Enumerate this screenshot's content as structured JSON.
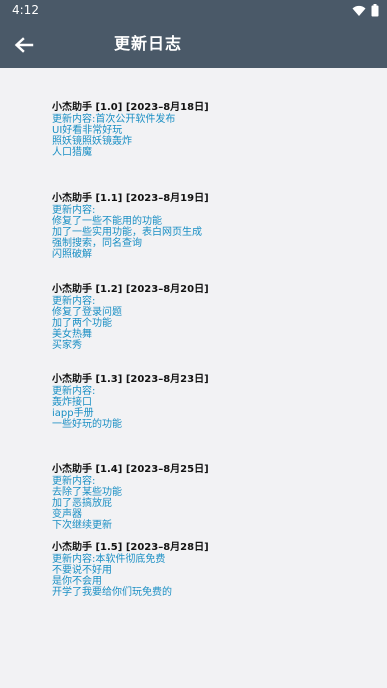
{
  "status_bar": {
    "time": "4:12"
  },
  "toolbar": {
    "title": "更新日志"
  },
  "logs": [
    {
      "title": "小杰助手 [1.0] [2023–8月18日]",
      "lines": [
        "更新内容:首次公开软件发布",
        "UI好看非常好玩",
        "照妖镜照妖镜轰炸",
        "人口猎魔"
      ]
    },
    {
      "title": "小杰助手 [1.1] [2023–8月19日]",
      "lines": [
        "更新内容:",
        "修复了一些不能用的功能",
        "加了一些实用功能，表白网页生成",
        "强制搜索，同名查询",
        "闪照破解"
      ]
    },
    {
      "title": "小杰助手 [1.2] [2023–8月20日]",
      "lines": [
        "更新内容:",
        "修复了登录问题",
        "加了两个功能",
        "美女热舞",
        "买家秀"
      ]
    },
    {
      "title": "小杰助手 [1.3] [2023–8月23日]",
      "lines": [
        "更新内容:",
        "轰炸接口",
        "iapp手册",
        "一些好玩的功能"
      ]
    },
    {
      "title": "小杰助手 [1.4] [2023–8月25日]",
      "lines": [
        "更新内容:",
        "去除了某些功能",
        "加了恶搞放屁",
        "变声器",
        "下次继续更新"
      ]
    },
    {
      "title": "小杰助手 [1.5] [2023–8月28日]",
      "lines": [
        "更新内容:本软件彻底免费",
        "不要说不好用",
        "是你不会用",
        "开学了我要给你们玩免费的"
      ]
    }
  ]
}
